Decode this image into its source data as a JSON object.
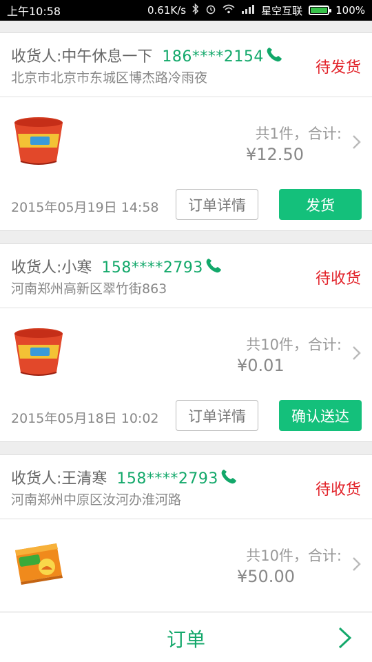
{
  "statusbar": {
    "time": "上午10:58",
    "speed": "0.61K/s",
    "carrier": "星空互联",
    "battery": "100%",
    "icons": [
      "bluetooth-icon",
      "alarm-icon",
      "wifi-icon",
      "signal-icon",
      "battery-icon"
    ]
  },
  "orders": [
    {
      "receiver": "收货人:中午休息一下",
      "phone": "186****2154",
      "address": "北京市北京市东城区博杰路冷雨夜",
      "status": "待发货",
      "product_icon": "instant-noodle-cup",
      "count_text": "共1件，合计:",
      "price": "¥12.50",
      "date": "2015年05月19日 14:58",
      "detail_label": "订单详情",
      "action_label": "发货"
    },
    {
      "receiver": "收货人:小寒",
      "phone": "158****2793",
      "address": "河南郑州高新区翠竹街863",
      "status": "待收货",
      "product_icon": "instant-noodle-cup",
      "count_text": "共10件，合计:",
      "price": "¥0.01",
      "date": "2015年05月18日 10:02",
      "detail_label": "订单详情",
      "action_label": "确认送达"
    },
    {
      "receiver": "收货人:王清寒",
      "phone": "158****2793",
      "address": "河南郑州中原区汝河办淮河路",
      "status": "待收货",
      "product_icon": "snack-box",
      "count_text": "共10件，合计:",
      "price": "¥50.00"
    }
  ],
  "bottombar": {
    "title": "订单"
  },
  "colors": {
    "accent": "#14c07b",
    "phone": "#12a86a",
    "status": "#e2232a"
  }
}
